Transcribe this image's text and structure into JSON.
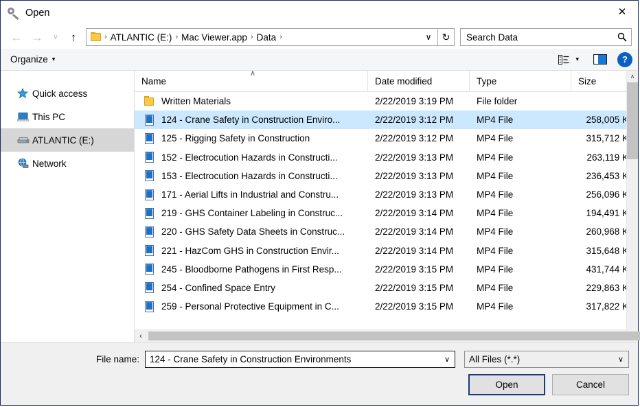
{
  "window": {
    "title": "Open",
    "title_icon": "key-icon",
    "close_label": "✕"
  },
  "nav": {
    "back": "←",
    "forward": "→",
    "recent": "∨",
    "up": "↑",
    "refresh": "↻",
    "address_chevron": "∨",
    "breadcrumbs": [
      "ATLANTIC (E:)",
      "Mac Viewer.app",
      "Data"
    ],
    "separator": "›"
  },
  "search": {
    "placeholder": "Search Data",
    "icon": "search-icon"
  },
  "command_bar": {
    "organize_label": "Organize",
    "organize_caret": "▾",
    "view_options_caret": "▾",
    "help_label": "?"
  },
  "sidebar": {
    "items": [
      {
        "label": "Quick access",
        "icon": "star-icon",
        "selected": false
      },
      {
        "label": "This PC",
        "icon": "monitor-icon",
        "selected": false
      },
      {
        "label": "ATLANTIC (E:)",
        "icon": "drive-icon",
        "selected": true
      },
      {
        "label": "Network",
        "icon": "network-globe-icon",
        "selected": false
      }
    ]
  },
  "file_list": {
    "columns": [
      "Name",
      "Date modified",
      "Type",
      "Size"
    ],
    "sort_caret": "∧",
    "rows": [
      {
        "name": "Written Materials",
        "date": "2/22/2019 3:19 PM",
        "type": "File folder",
        "size": "",
        "icon": "folder-icon",
        "selected": false
      },
      {
        "name": "124 - Crane Safety in Construction Enviro...",
        "date": "2/22/2019 3:12 PM",
        "type": "MP4 File",
        "size": "258,005 K",
        "icon": "mp4-icon",
        "selected": true
      },
      {
        "name": "125 - Rigging Safety in Construction",
        "date": "2/22/2019 3:12 PM",
        "type": "MP4 File",
        "size": "315,712 K",
        "icon": "mp4-icon",
        "selected": false
      },
      {
        "name": "152 - Electrocution Hazards in Constructi...",
        "date": "2/22/2019 3:13 PM",
        "type": "MP4 File",
        "size": "263,119 K",
        "icon": "mp4-icon",
        "selected": false
      },
      {
        "name": "153 - Electrocution Hazards in Constructi...",
        "date": "2/22/2019 3:13 PM",
        "type": "MP4 File",
        "size": "236,453 K",
        "icon": "mp4-icon",
        "selected": false
      },
      {
        "name": "171 - Aerial Lifts in Industrial and Constru...",
        "date": "2/22/2019 3:13 PM",
        "type": "MP4 File",
        "size": "256,096 K",
        "icon": "mp4-icon",
        "selected": false
      },
      {
        "name": "219 - GHS Container Labeling in Construc...",
        "date": "2/22/2019 3:14 PM",
        "type": "MP4 File",
        "size": "194,491 K",
        "icon": "mp4-icon",
        "selected": false
      },
      {
        "name": "220 - GHS Safety Data Sheets in Construc...",
        "date": "2/22/2019 3:14 PM",
        "type": "MP4 File",
        "size": "260,968 K",
        "icon": "mp4-icon",
        "selected": false
      },
      {
        "name": "221 - HazCom GHS in Construction Envir...",
        "date": "2/22/2019 3:14 PM",
        "type": "MP4 File",
        "size": "315,648 K",
        "icon": "mp4-icon",
        "selected": false
      },
      {
        "name": "245 - Bloodborne Pathogens in First Resp...",
        "date": "2/22/2019 3:15 PM",
        "type": "MP4 File",
        "size": "431,744 K",
        "icon": "mp4-icon",
        "selected": false
      },
      {
        "name": "254 - Confined Space Entry",
        "date": "2/22/2019 3:15 PM",
        "type": "MP4 File",
        "size": "229,863 K",
        "icon": "mp4-icon",
        "selected": false
      },
      {
        "name": "259 - Personal Protective Equipment in C...",
        "date": "2/22/2019 3:15 PM",
        "type": "MP4 File",
        "size": "317,822 K",
        "icon": "mp4-icon",
        "selected": false
      }
    ]
  },
  "scrollbars": {
    "v_up": "∧",
    "v_down": "∨",
    "h_left": "‹",
    "h_right": "›"
  },
  "footer": {
    "file_name_label": "File name:",
    "file_name_value": "124 - Crane Safety in Construction Environments",
    "filter_value": "All Files (*.*)",
    "combo_arrow": "∨",
    "open_label": "Open",
    "cancel_label": "Cancel"
  },
  "colors": {
    "selection_blue": "#cce8ff",
    "accent_blue": "#0a5fc4",
    "folder_yellow": "#fcc947",
    "window_border": "#1b2a5e"
  }
}
